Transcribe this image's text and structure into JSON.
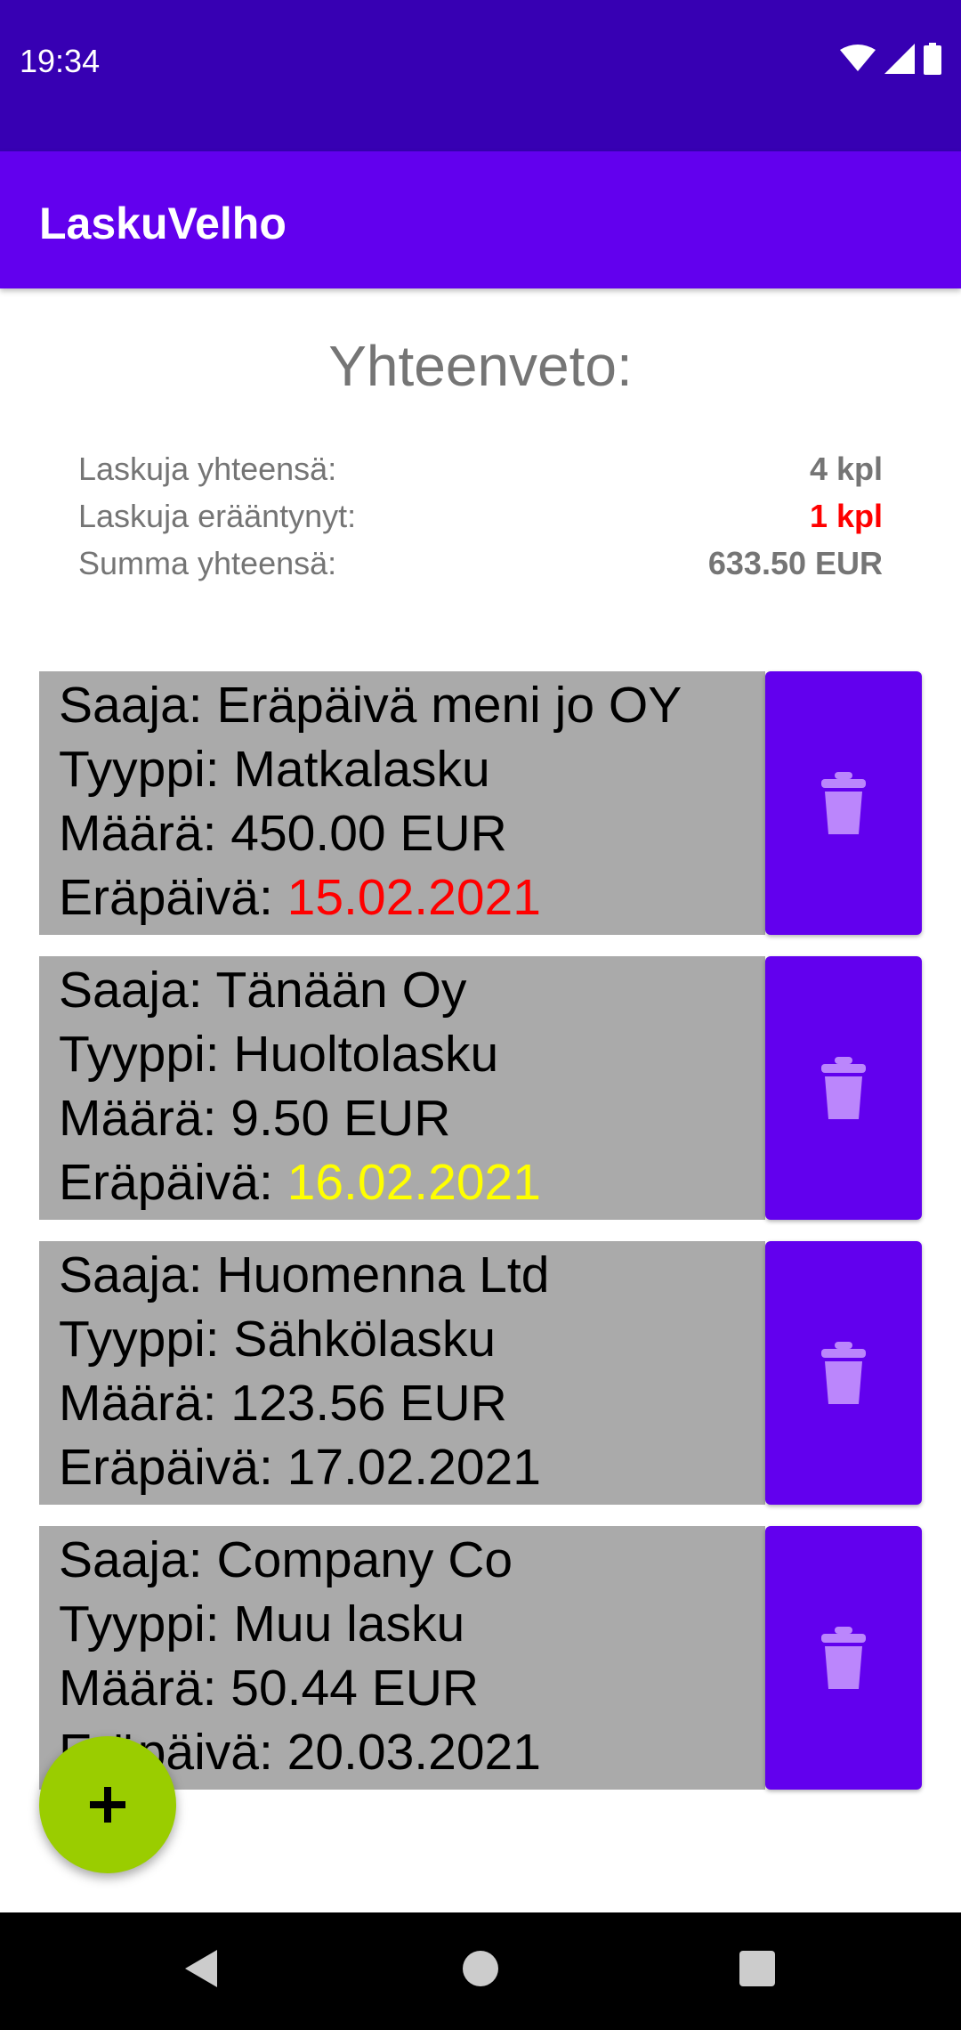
{
  "status_bar": {
    "time": "19:34",
    "icons": [
      "wifi-icon",
      "signal-icon",
      "battery-icon"
    ]
  },
  "app_bar": {
    "title": "LaskuVelho"
  },
  "summary": {
    "title": "Yhteenveto:",
    "rows": [
      {
        "label": "Laskuja yhteensä:",
        "value": "4 kpl"
      },
      {
        "label": "Laskuja erääntynyt:",
        "value": "1 kpl"
      },
      {
        "label": "Summa yhteensä:",
        "value": "633.50 EUR"
      }
    ]
  },
  "invoice_labels": {
    "recipient": "Saaja: ",
    "type": "Tyyppi: ",
    "amount": "Määrä: ",
    "due": "Eräpäivä: "
  },
  "invoices": [
    {
      "recipient": "Eräpäivä meni jo OY",
      "type": "Matkalasku",
      "amount": "450.00 EUR",
      "due": "15.02.2021",
      "due_status": "overdue"
    },
    {
      "recipient": "Tänään Oy",
      "type": "Huoltolasku",
      "amount": "9.50 EUR",
      "due": "16.02.2021",
      "due_status": "today"
    },
    {
      "recipient": "Huomenna Ltd",
      "type": "Sähkölasku",
      "amount": "123.56 EUR",
      "due": "17.02.2021",
      "due_status": "upcoming"
    },
    {
      "recipient": "Company Co",
      "type": "Muu lasku",
      "amount": "50.44 EUR",
      "due": "20.03.2021",
      "due_status": "upcoming"
    }
  ],
  "colors": {
    "status_bar": "#3700b3",
    "app_bar": "#6200ee",
    "card_bg": "#aaaaaa",
    "delete_button": "#6200ee",
    "overdue": "#ff0000",
    "due_today": "#ffff00",
    "fab": "#9acd00"
  },
  "fab": {
    "icon": "plus-icon"
  },
  "nav_bar": {
    "icons": [
      "back-icon",
      "home-icon",
      "recents-icon"
    ]
  }
}
